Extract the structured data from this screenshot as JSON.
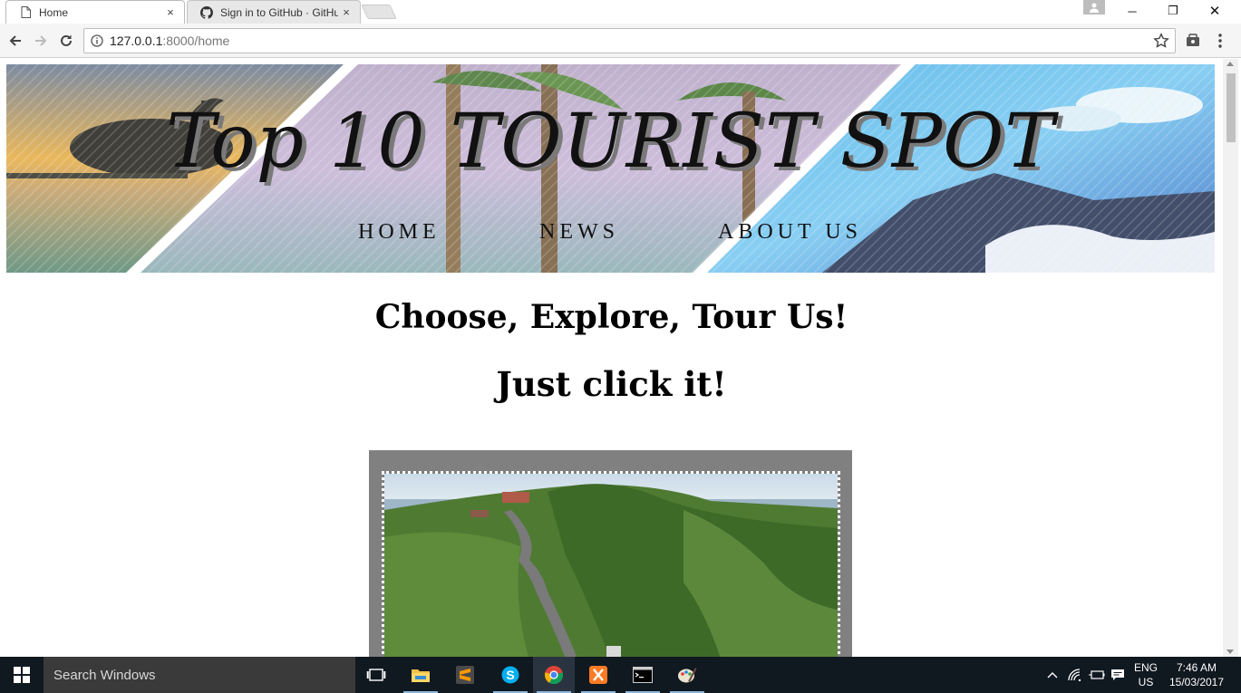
{
  "browser": {
    "tabs": [
      {
        "title": "Home",
        "icon": "page-icon",
        "active": true
      },
      {
        "title": "Sign in to GitHub · GitHu",
        "icon": "github-icon",
        "active": false
      }
    ],
    "tab_close_glyph": "×",
    "address": {
      "host": "127.0.0.1",
      "path": ":8000/home"
    },
    "window_controls": {
      "minimize": "─",
      "restore": "❐",
      "close": "✕"
    }
  },
  "page": {
    "site_title": "Top 10 TOURIST SPOT",
    "nav": [
      {
        "label": "HOME"
      },
      {
        "label": "NEWS"
      },
      {
        "label": "ABOUT US"
      }
    ],
    "headline_1": "Choose, Explore, Tour Us!",
    "headline_2": "Just click it!"
  },
  "taskbar": {
    "search_placeholder": "Search Windows",
    "language": {
      "line1": "ENG",
      "line2": "US"
    },
    "clock": {
      "time": "7:46 AM",
      "date": "15/03/2017"
    },
    "apps": [
      "task-view-icon",
      "file-explorer-icon",
      "sublime-text-icon",
      "skype-icon",
      "chrome-icon",
      "xampp-icon",
      "command-prompt-icon",
      "paint-icon"
    ]
  },
  "colors": {
    "frame_gray": "#808080",
    "taskbar_bg": "#101820",
    "search_bg": "#3a3a3a"
  }
}
